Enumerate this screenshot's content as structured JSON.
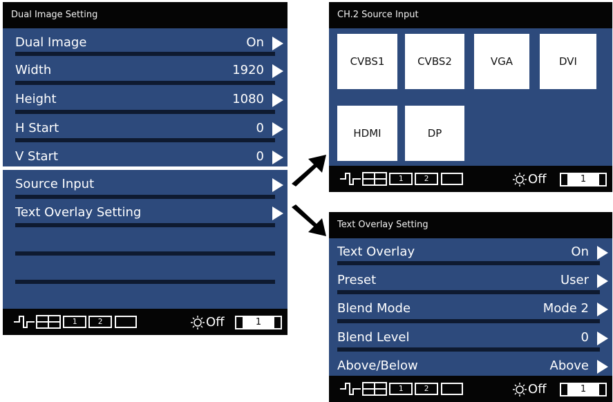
{
  "dual_panel": {
    "title": "Dual Image Setting",
    "items": [
      {
        "label": "Dual Image",
        "value": "On"
      },
      {
        "label": "Width",
        "value": "1920"
      },
      {
        "label": "Height",
        "value": "1080"
      },
      {
        "label": "H Start",
        "value": "0"
      },
      {
        "label": "V Start",
        "value": "0"
      },
      {
        "label": "Source Input",
        "value": ""
      },
      {
        "label": "Text Overlay Setting",
        "value": ""
      }
    ]
  },
  "source_panel": {
    "title": "CH.2 Source Input",
    "tiles": [
      "CVBS1",
      "CVBS2",
      "VGA",
      "DVI",
      "HDMI",
      "DP"
    ]
  },
  "overlay_panel": {
    "title": "Text Overlay Setting",
    "items": [
      {
        "label": "Text Overlay",
        "value": "On"
      },
      {
        "label": "Preset",
        "value": "User"
      },
      {
        "label": "Blend Mode",
        "value": "Mode 2"
      },
      {
        "label": "Blend Level",
        "value": "0"
      },
      {
        "label": "Above/Below",
        "value": "Above"
      }
    ]
  },
  "status_bar": {
    "box1": "1",
    "box2": "2",
    "off_label": "Off",
    "input_number": "1"
  },
  "colors": {
    "panel_bg": "#2d4a7c",
    "title_bg": "#050505",
    "text": "#ffffff"
  },
  "icons": [
    "waveform-icon",
    "split-screen-icon",
    "pip-window-1-icon",
    "pip-window-2-icon",
    "single-window-icon",
    "sun-icon",
    "right-arrow-icon",
    "big-black-arrow-icon"
  ]
}
